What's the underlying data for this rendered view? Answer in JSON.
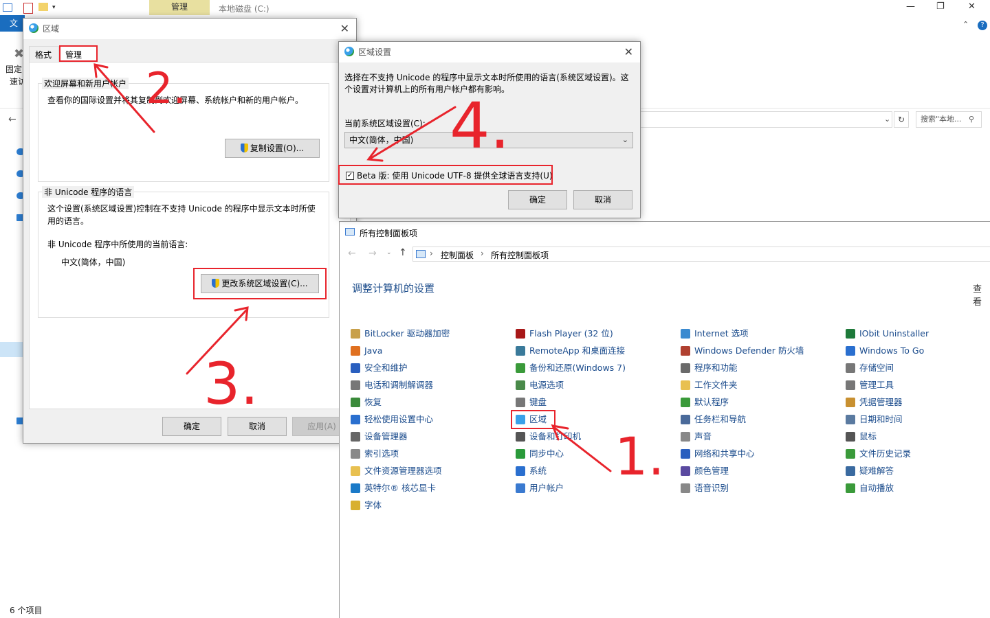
{
  "explorer": {
    "tab_manage": "管理",
    "drive_title": "本地磁盘 (C:)",
    "file_tab": "文件",
    "pin_label": "固定",
    "quick_label": "速访",
    "search_placeholder": "搜索\"本地...",
    "status_items": "6 个项目",
    "win_minimize": "—",
    "win_restore": "❐",
    "win_close": "✕",
    "help": "?"
  },
  "region_dialog": {
    "title": "区域",
    "tabs": [
      "格式",
      "管理"
    ],
    "welcome_group": {
      "legend": "欢迎屏幕和新用户帐户",
      "description": "查看你的国际设置并将其复制到欢迎屏幕、系统帐户和新的用户帐户。",
      "copy_button": "复制设置(O)..."
    },
    "nonunicode_group": {
      "legend": "非 Unicode 程序的语言",
      "description": "这个设置(系统区域设置)控制在不支持 Unicode 的程序中显示文本时所使用的语言。",
      "current_label": "非 Unicode 程序中所使用的当前语言:",
      "current_value": "中文(简体，中国)",
      "change_button": "更改系统区域设置(C)..."
    },
    "ok": "确定",
    "cancel": "取消",
    "apply": "应用(A)"
  },
  "region_settings_dialog": {
    "title": "区域设置",
    "description": "选择在不支持 Unicode 的程序中显示文本时所使用的语言(系统区域设置)。这个设置对计算机上的所有用户帐户都有影响。",
    "current_label": "当前系统区域设置(C):",
    "current_value": "中文(简体，中国)",
    "beta_checkbox_label": "Beta 版: 使用 Unicode UTF-8 提供全球语言支持(U)",
    "beta_checked": true,
    "ok": "确定",
    "cancel": "取消"
  },
  "control_panel": {
    "title": "所有控制面板项",
    "breadcrumb": [
      "控制面板",
      "所有控制面板项"
    ],
    "heading": "调整计算机的设置",
    "view_by": "查看",
    "columns": [
      [
        {
          "label": "BitLocker 驱动器加密",
          "icon": "bitlocker-icon",
          "color": "#c8a04a"
        },
        {
          "label": "Java",
          "icon": "java-icon",
          "color": "#e07020"
        },
        {
          "label": "安全和维护",
          "icon": "flag-icon",
          "color": "#2a5fbf"
        },
        {
          "label": "电话和调制解调器",
          "icon": "phone-icon",
          "color": "#777777"
        },
        {
          "label": "恢复",
          "icon": "recovery-icon",
          "color": "#3a8a3a"
        },
        {
          "label": "轻松使用设置中心",
          "icon": "ease-of-access-icon",
          "color": "#2a6fcf"
        },
        {
          "label": "设备管理器",
          "icon": "device-manager-icon",
          "color": "#666666"
        },
        {
          "label": "索引选项",
          "icon": "indexing-icon",
          "color": "#888888"
        },
        {
          "label": "文件资源管理器选项",
          "icon": "folder-options-icon",
          "color": "#e8c050"
        },
        {
          "label": "英特尔® 核芯显卡",
          "icon": "intel-graphics-icon",
          "color": "#1a7ac8"
        },
        {
          "label": "字体",
          "icon": "font-icon",
          "color": "#d8b030"
        }
      ],
      [
        {
          "label": "Flash Player (32 位)",
          "icon": "flash-icon",
          "color": "#a81818"
        },
        {
          "label": "RemoteApp 和桌面连接",
          "icon": "remoteapp-icon",
          "color": "#3a7a9a"
        },
        {
          "label": "备份和还原(Windows 7)",
          "icon": "backup-icon",
          "color": "#3a9a3a"
        },
        {
          "label": "电源选项",
          "icon": "power-icon",
          "color": "#4a8a4a"
        },
        {
          "label": "键盘",
          "icon": "keyboard-icon",
          "color": "#777777"
        },
        {
          "label": "区域",
          "icon": "region-icon",
          "color": "#3aa0e8"
        },
        {
          "label": "设备和打印机",
          "icon": "printer-icon",
          "color": "#555555"
        },
        {
          "label": "同步中心",
          "icon": "sync-icon",
          "color": "#2a9a3a"
        },
        {
          "label": "系统",
          "icon": "system-icon",
          "color": "#2a6fcf"
        },
        {
          "label": "用户帐户",
          "icon": "user-accounts-icon",
          "color": "#3a7ad0"
        }
      ],
      [
        {
          "label": "Internet 选项",
          "icon": "internet-options-icon",
          "color": "#3a8ad0"
        },
        {
          "label": "Windows Defender 防火墙",
          "icon": "firewall-icon",
          "color": "#b04030"
        },
        {
          "label": "程序和功能",
          "icon": "programs-icon",
          "color": "#6a6a6a"
        },
        {
          "label": "工作文件夹",
          "icon": "work-folders-icon",
          "color": "#e8c050"
        },
        {
          "label": "默认程序",
          "icon": "default-programs-icon",
          "color": "#3a9a3a"
        },
        {
          "label": "任务栏和导航",
          "icon": "taskbar-icon",
          "color": "#4a6a9a"
        },
        {
          "label": "声音",
          "icon": "sound-icon",
          "color": "#888888"
        },
        {
          "label": "网络和共享中心",
          "icon": "network-icon",
          "color": "#2a5fbf"
        },
        {
          "label": "颜色管理",
          "icon": "color-management-icon",
          "color": "#5a4aa0"
        },
        {
          "label": "语音识别",
          "icon": "microphone-icon",
          "color": "#888888"
        }
      ],
      [
        {
          "label": "IObit Uninstaller",
          "icon": "iobit-icon",
          "color": "#1e7a3a"
        },
        {
          "label": "Windows To Go",
          "icon": "windows-to-go-icon",
          "color": "#2a6fcf"
        },
        {
          "label": "存储空间",
          "icon": "storage-icon",
          "color": "#777777"
        },
        {
          "label": "管理工具",
          "icon": "admin-tools-icon",
          "color": "#777777"
        },
        {
          "label": "凭据管理器",
          "icon": "credential-icon",
          "color": "#c89030"
        },
        {
          "label": "日期和时间",
          "icon": "clock-icon",
          "color": "#5a7aa0"
        },
        {
          "label": "鼠标",
          "icon": "mouse-icon",
          "color": "#555555"
        },
        {
          "label": "文件历史记录",
          "icon": "file-history-icon",
          "color": "#3a9a3a"
        },
        {
          "label": "疑难解答",
          "icon": "troubleshoot-icon",
          "color": "#3a6aa0"
        },
        {
          "label": "自动播放",
          "icon": "autoplay-icon",
          "color": "#3a9a3a"
        }
      ]
    ]
  },
  "annotations": {
    "step1": "1.",
    "step2": "2.",
    "step3": "3.",
    "step4": "4.",
    "color": "#e8242c"
  }
}
